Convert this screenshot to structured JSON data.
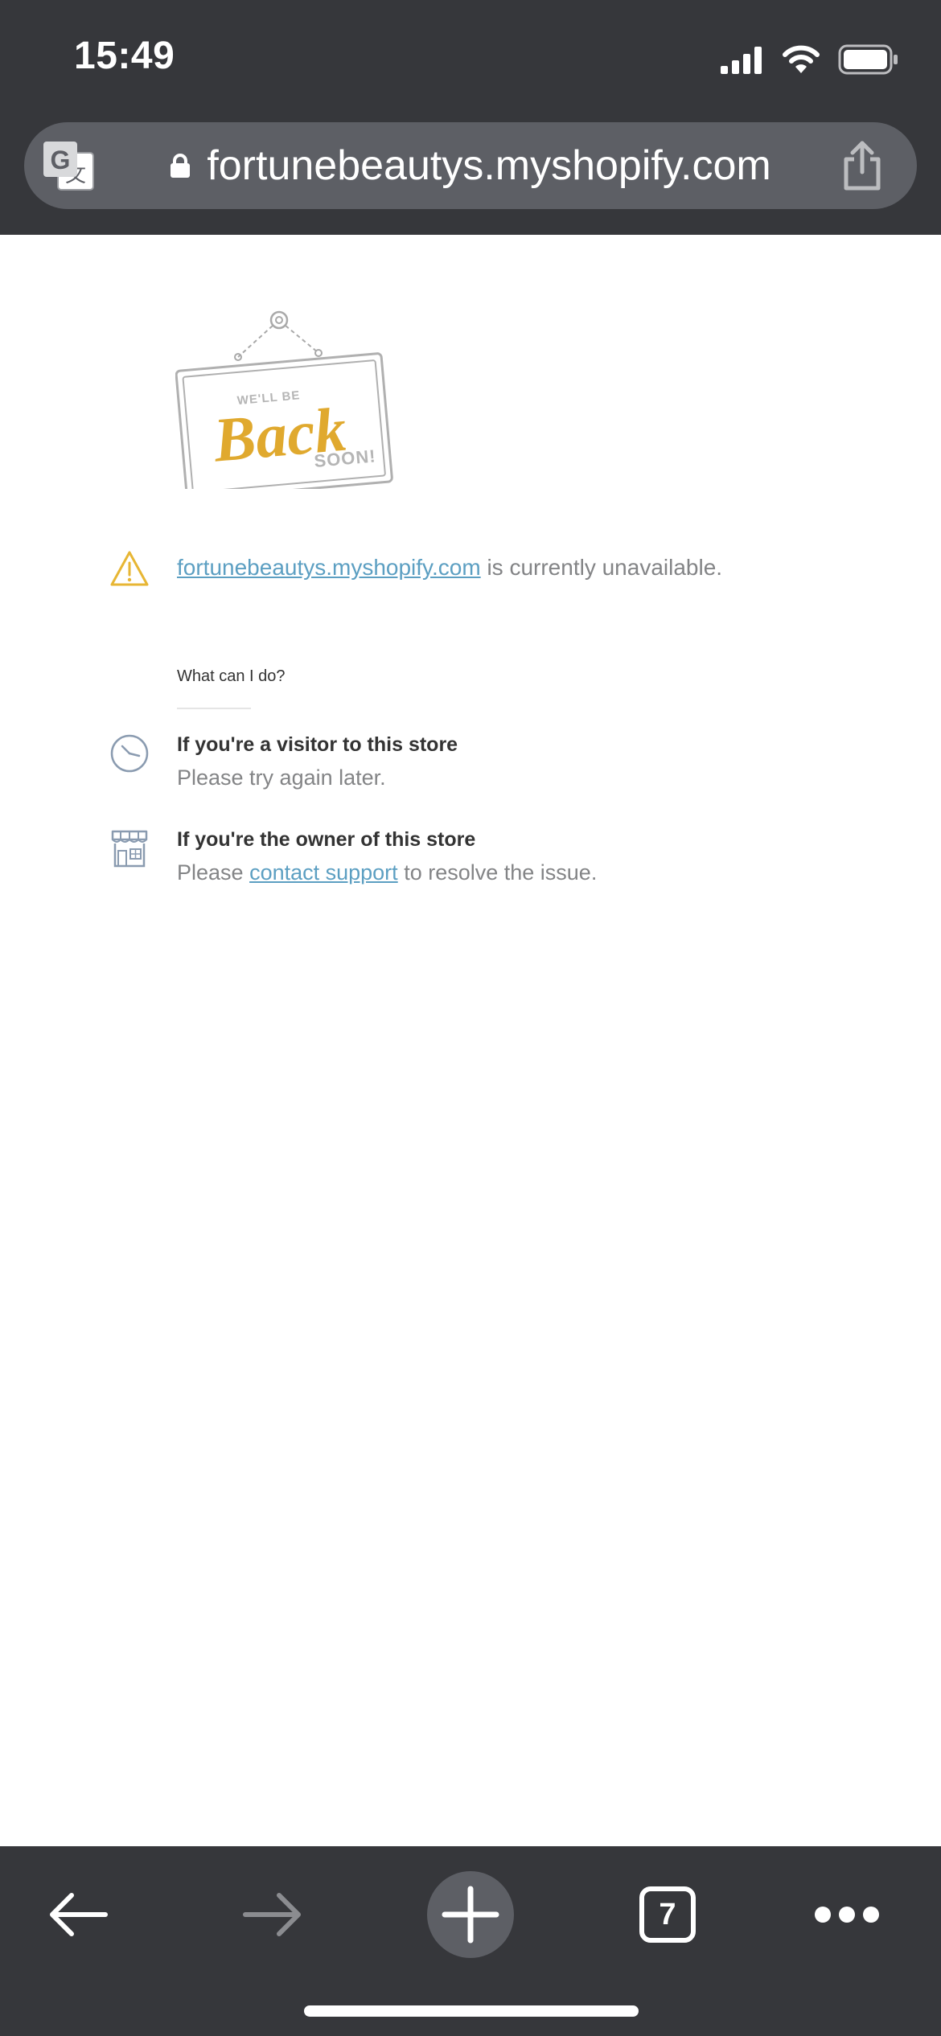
{
  "status_bar": {
    "time": "15:49"
  },
  "address_bar": {
    "url": "fortunebeautys.myshopify.com",
    "icons": [
      "translate-icon",
      "lock-icon",
      "share-icon"
    ]
  },
  "page": {
    "sign_image": {
      "line1": "WE'LL BE",
      "line2": "Back",
      "line3": "SOON!"
    },
    "notice": {
      "link_text": "fortunebeautys.myshopify.com",
      "suffix": " is currently unavailable."
    },
    "what_heading": "What can I do?",
    "visitor": {
      "title": "If you're a visitor to this store",
      "description": "Please try again later."
    },
    "owner": {
      "title": "If you're the owner of this store",
      "prefix": "Please ",
      "link_text": "contact support",
      "suffix": " to resolve the issue."
    }
  },
  "toolbar": {
    "tab_count": "7",
    "icons": [
      "back-arrow-icon",
      "forward-arrow-icon",
      "plus-icon",
      "tabs-icon",
      "more-icon"
    ]
  },
  "colors": {
    "chrome_bg": "#36373b",
    "address_bar_bg": "#5d5f65",
    "link": "#5c9fc2",
    "sign_accent": "#e0a92e",
    "warning": "#e7b634",
    "muted_text": "#838486"
  }
}
